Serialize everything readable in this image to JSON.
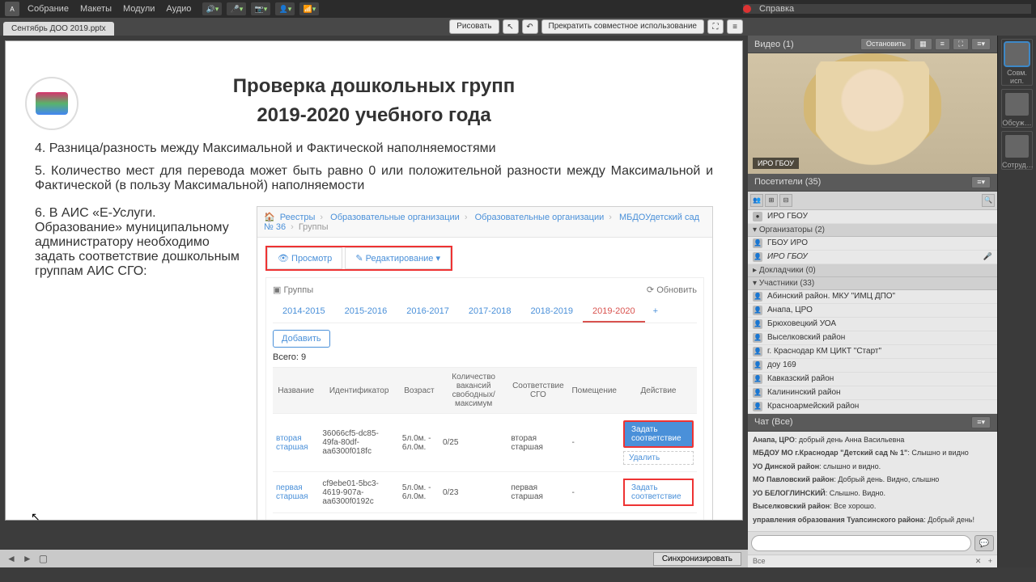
{
  "topbar": {
    "logo": "A",
    "menus": [
      "Собрание",
      "Макеты",
      "Модули",
      "Аудио"
    ],
    "help": "Справка"
  },
  "tab": {
    "filename": "Сентябрь ДОО 2019.pptx"
  },
  "doc_tools": {
    "draw": "Рисовать",
    "stop_share": "Прекратить совместное использование"
  },
  "slide": {
    "title1": "Проверка дошкольных групп",
    "title2": "2019-2020 учебного года",
    "p4": "4. Разница/разность между Максимальной и Фактической наполняемостями",
    "p5": "5. Количество мест для перевода может быть равно 0 или положительной разности между Максимальной и Фактической (в пользу Максимальной) наполняемости",
    "p6": "6. В АИС «Е-Услуги. Образование» муниципальному администратору необходимо задать соответствие дошкольным группам АИС СГО:"
  },
  "ais": {
    "breadcrumb": [
      "Реестры",
      "Образовательные организации",
      "Образовательные организации",
      "МБДОУдетский сад № 36",
      "Группы"
    ],
    "view": "Просмотр",
    "edit": "Редактирование",
    "groups": "Группы",
    "refresh": "Обновить",
    "years": [
      "2014-2015",
      "2015-2016",
      "2016-2017",
      "2017-2018",
      "2018-2019",
      "2019-2020"
    ],
    "active_year": "2019-2020",
    "add": "Добавить",
    "total": "Всего: 9",
    "cols": [
      "Название",
      "Идентификатор",
      "Возраст",
      "Количество вакансий свободных/максимум",
      "Соответствие СГО",
      "Помещение",
      "Действие"
    ],
    "rows": [
      {
        "name": "вторая старшая",
        "id": "36066cf5-dc85-49fa-80df-aa6300f018fc",
        "age": "5л.0м. - 6л.0м.",
        "vac": "0/25",
        "sgo": "вторая старшая",
        "room": "-",
        "action": "Задать соответствие",
        "action2": "Удалить"
      },
      {
        "name": "первая старшая",
        "id": "cf9ebe01-5bc3-4619-907a-aa6300f0192c",
        "age": "5л.0м. - 6л.0м.",
        "vac": "0/23",
        "sgo": "первая старшая",
        "room": "-",
        "action": "Задать соответствие"
      }
    ]
  },
  "nav": {
    "sync": "Синхронизировать"
  },
  "video": {
    "title": "Видео",
    "count": "(1)",
    "stop": "Остановить",
    "name": "ИРО ГБОУ"
  },
  "attendees": {
    "title": "Посетители",
    "count": "(35)",
    "me": "ИРО ГБОУ",
    "group_org": "Организаторы (2)",
    "orgs": [
      "ГБОУ ИРО",
      "ИРО ГБОУ"
    ],
    "group_spk": "Докладчики (0)",
    "group_par": "Участники (33)",
    "parts": [
      "Абинский район. МКУ \"ИМЦ ДПО\"",
      "Анапа, ЦРО",
      "Брюховецкий УОА",
      "Выселковский район",
      "г. Краснодар КМ ЦИКТ \"Старт\"",
      "доу 169",
      "Кавказский район",
      "Калининский район",
      "Красноармейский район"
    ]
  },
  "chat": {
    "title": "Чат",
    "scope": "(Все)",
    "msgs": [
      {
        "u": "Анапа, ЦРО",
        "t": "добрый день Анна Васильевна"
      },
      {
        "u": "МБДОУ МО г.Краснодар \"Детский сад № 1\"",
        "t": "Слышно и видно"
      },
      {
        "u": "УО Динской район",
        "t": "слышно и видно."
      },
      {
        "u": "МО Павловский район",
        "t": "Добрый день. Видно, слышно"
      },
      {
        "u": "УО БЕЛОГЛИНСКИЙ",
        "t": "Слышно. Видно."
      },
      {
        "u": "Выселковский район",
        "t": "Все хорошо."
      },
      {
        "u": "управления образования Туапсинского района",
        "t": "Добрый день!"
      }
    ],
    "footer": "Все"
  },
  "side": {
    "p1": "Совм. исп.",
    "p2": "Обсуж…",
    "p3": "Сотруд…"
  }
}
